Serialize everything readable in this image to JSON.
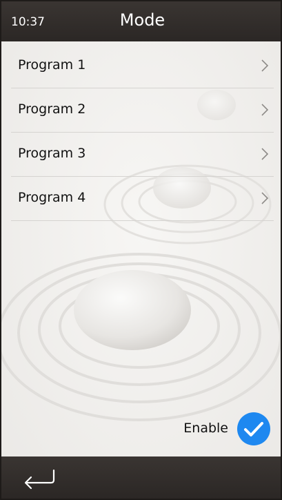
{
  "status": {
    "time": "10:37"
  },
  "header": {
    "title": "Mode"
  },
  "programs": [
    {
      "label": "Program 1"
    },
    {
      "label": "Program 2"
    },
    {
      "label": "Program 3"
    },
    {
      "label": "Program 4"
    }
  ],
  "enable": {
    "label": "Enable",
    "checked": true
  },
  "icons": {
    "chevron": "chevron-right-icon",
    "check": "check-icon",
    "back": "back-arrow-icon"
  },
  "colors": {
    "header": "#2f2a28",
    "accent": "#1e88f0",
    "text": "#111111"
  }
}
